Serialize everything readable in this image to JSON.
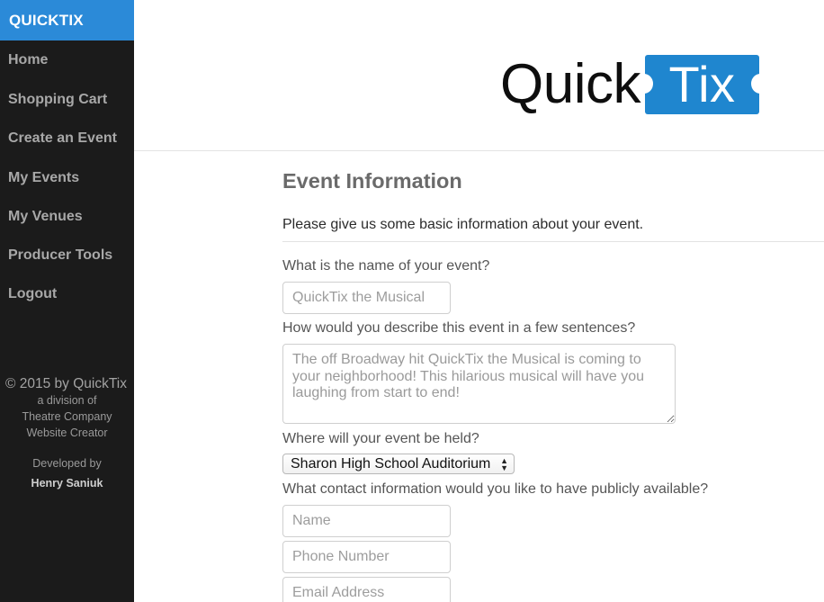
{
  "sidebar": {
    "brand": "QUICKTIX",
    "items": [
      {
        "label": "Home"
      },
      {
        "label": "Shopping Cart"
      },
      {
        "label": "Create an Event"
      },
      {
        "label": "My Events"
      },
      {
        "label": "My Venues"
      },
      {
        "label": "Producer Tools"
      },
      {
        "label": "Logout"
      }
    ],
    "footer": {
      "copyright": "© 2015 by QuickTix",
      "line1": "a division of",
      "line2": "Theatre Company",
      "line3": "Website Creator",
      "developed_by": "Developed by",
      "author": "Henry Saniuk"
    }
  },
  "header": {
    "logo_quick": "Quick",
    "logo_tix": "Tix"
  },
  "form": {
    "title": "Event Information",
    "intro": "Please give us some basic information about your event.",
    "name_question": "What is the name of your event?",
    "name_placeholder": "QuickTix the Musical",
    "description_question": "How would you describe this event in a few sentences?",
    "description_placeholder": "The off Broadway hit QuickTix the Musical is coming to your neighborhood! This hilarious musical will have you laughing from start to end!",
    "venue_question": "Where will your event be held?",
    "venue_selected": "Sharon High School Auditorium",
    "contact_question": "What contact information would you like to have publicly available?",
    "contact_name_placeholder": "Name",
    "contact_phone_placeholder": "Phone Number",
    "contact_email_placeholder": "Email Address"
  },
  "colors": {
    "brand_blue": "#2b8ad8",
    "sidebar_bg": "#1b1b1b",
    "logo_blue": "#1f86cf"
  }
}
